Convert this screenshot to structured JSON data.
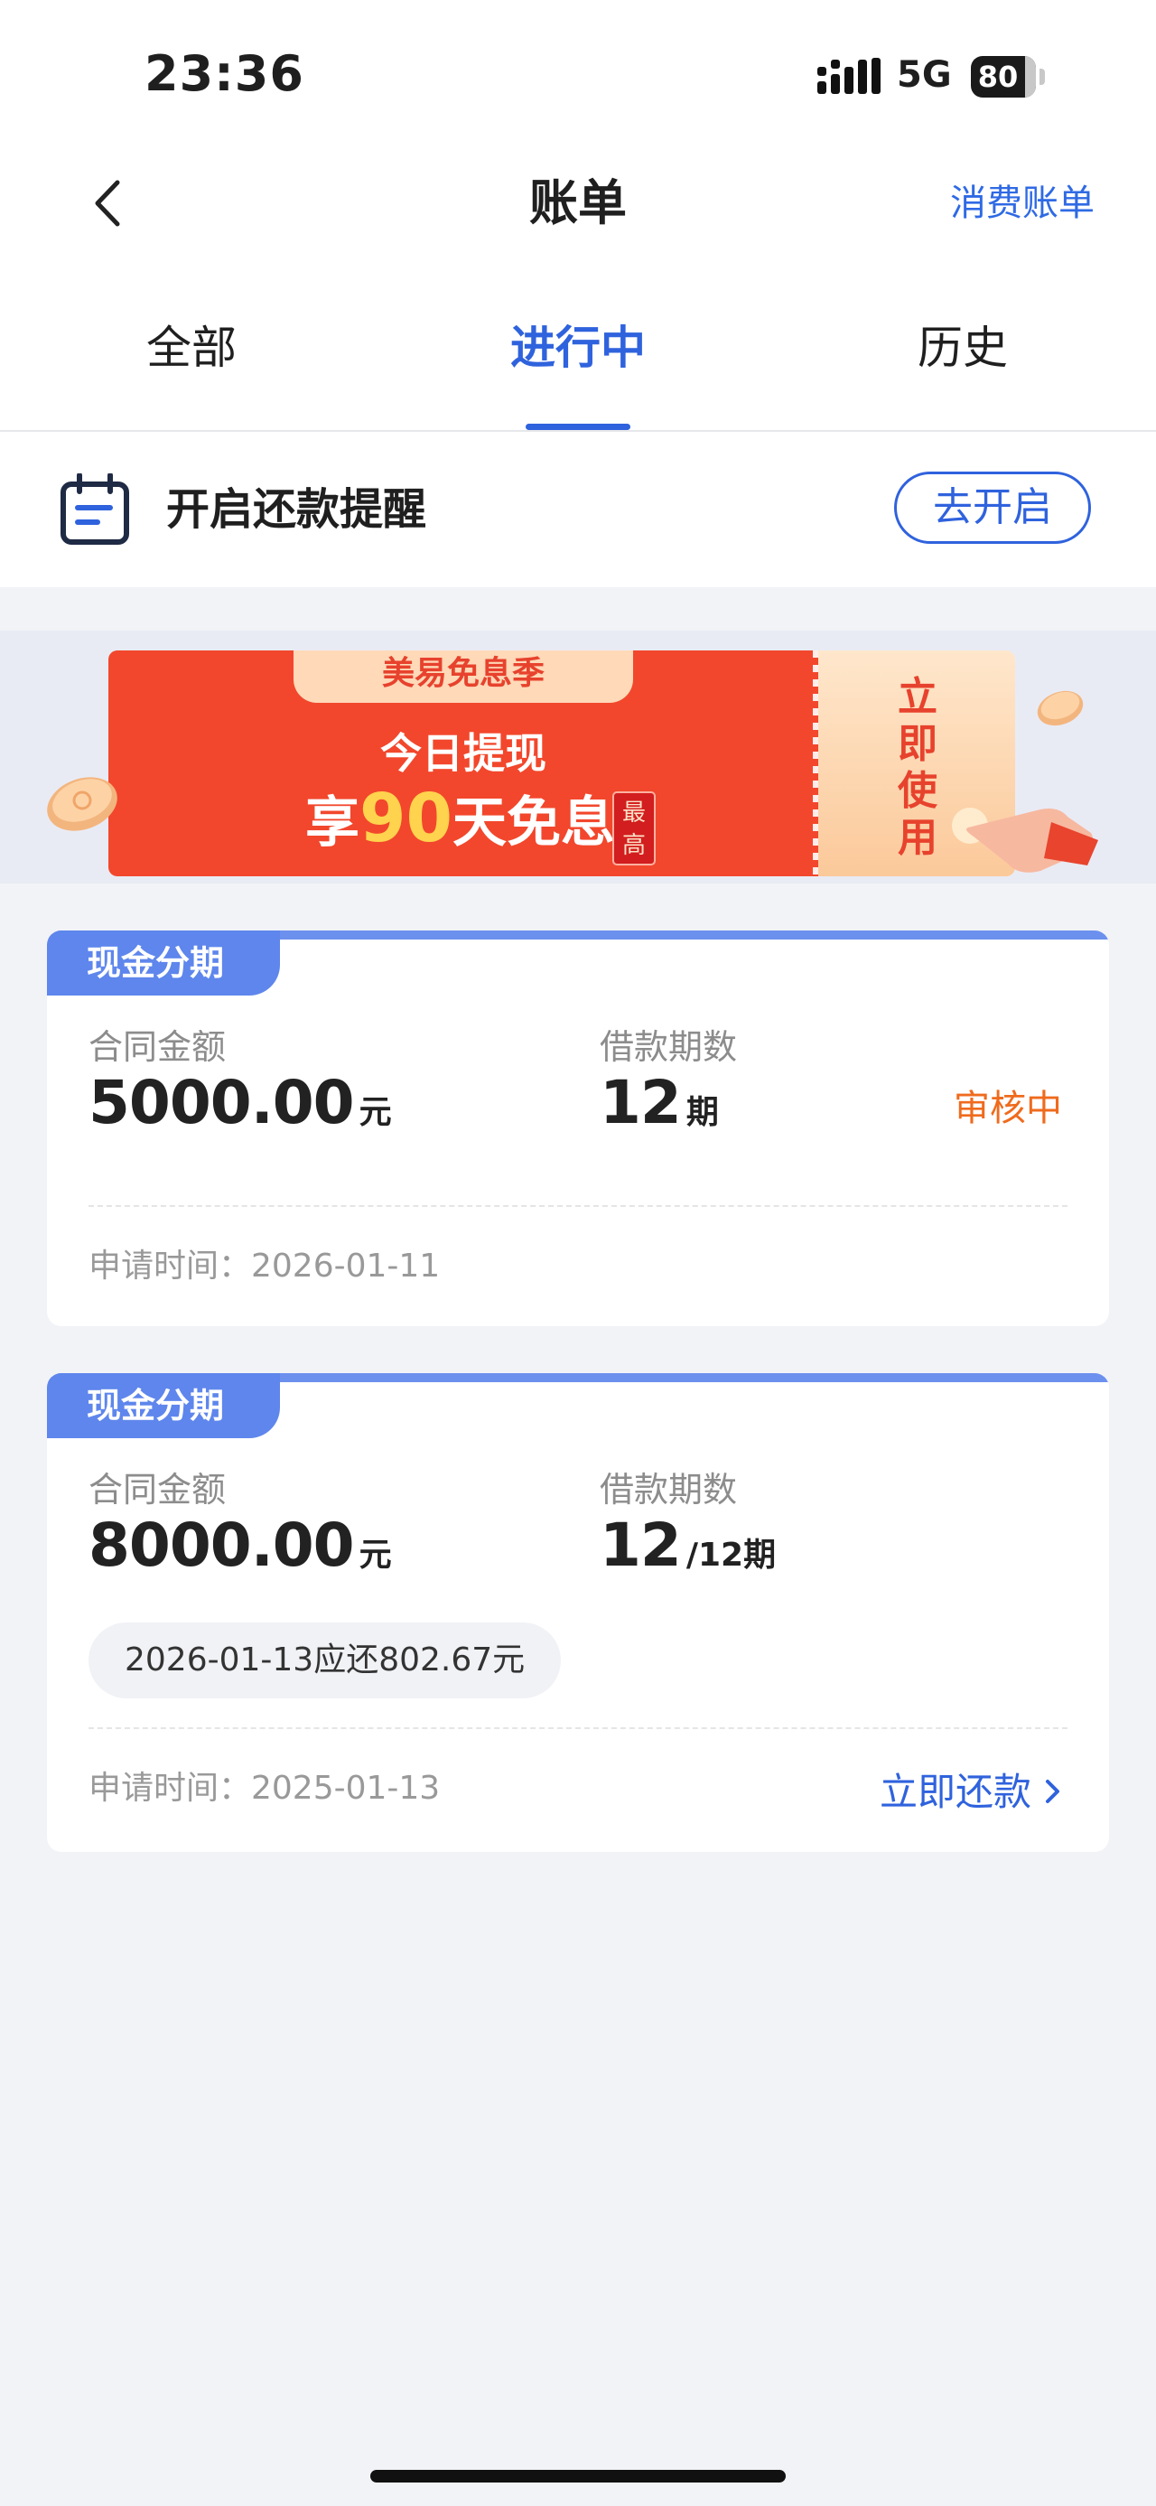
{
  "status_bar": {
    "time": "23:36",
    "network": "5G",
    "battery": "80"
  },
  "nav": {
    "title": "账单",
    "right_link": "消费账单",
    "back_icon": "chevron-left-icon"
  },
  "tabs": [
    {
      "label": "全部",
      "active": false
    },
    {
      "label": "进行中",
      "active": true
    },
    {
      "label": "历史",
      "active": false
    }
  ],
  "reminder": {
    "label": "开启还款提醒",
    "button": "去开启",
    "icon": "calendar-icon"
  },
  "promo": {
    "tag": "美易免息季",
    "line1": "今日提现",
    "line2_prefix": "享",
    "line2_number": "90",
    "line2_suffix": "天免息",
    "badge": "最高",
    "stub": "立即使用"
  },
  "bills": [
    {
      "tag": "现金分期",
      "amount_label": "合同金额",
      "amount": "5000.00",
      "amount_unit": "元",
      "periods_label": "借款期数",
      "periods": "12",
      "periods_unit": "期",
      "status": "审核中",
      "apply_time": "申请时间：2026-01-11"
    },
    {
      "tag": "现金分期",
      "amount_label": "合同金额",
      "amount": "8000.00",
      "amount_unit": "元",
      "periods_label": "借款期数",
      "periods": "12",
      "periods_unit": "/12期",
      "due_text": "2026-01-13应还802.67元",
      "apply_time": "申请时间：2025-01-13",
      "action": "立即还款"
    }
  ],
  "colors": {
    "accent": "#2f62dd",
    "status_orange": "#ef6b1d",
    "promo_red": "#f2472c",
    "background": "#f2f3f7"
  }
}
